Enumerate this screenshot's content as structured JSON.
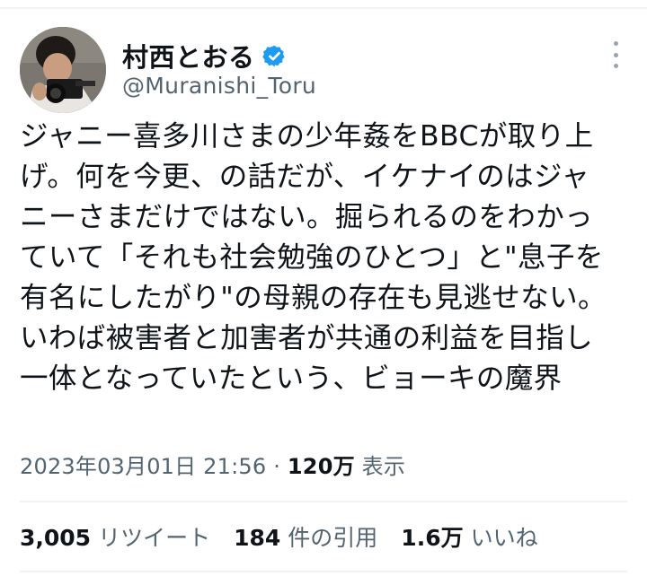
{
  "author": {
    "display_name": "村西とおる",
    "handle": "@Muranishi_Toru",
    "verified_color": "#1d9bf0"
  },
  "tweet": {
    "lines": [
      "ジャニー喜多川さまの少年姦をBBCが取り上",
      "げ。何を今更、の話だが、イケナイのはジャ",
      "ニーさまだけではない。掘られるのをわかっ",
      "ていて「それも社会勉強のひとつ」と\"息子を",
      "有名にしたがり\"の母親の存在も見逃せない。",
      "いわば被害者と加害者が共通の利益を目指し",
      "一体となっていたという、ビョーキの魔界"
    ],
    "timestamp": "2023年03月01日 21:56",
    "separator": "·",
    "views_count": "120万",
    "views_label": "表示"
  },
  "stats": {
    "retweets_count": "3,005",
    "retweets_label": "リツイート",
    "quotes_count": "184",
    "quotes_label": "件の引用",
    "likes_count": "1.6万",
    "likes_label": "いいね"
  },
  "icons": {
    "more": "more-vertical-icon",
    "verified": "verified-badge-icon"
  }
}
